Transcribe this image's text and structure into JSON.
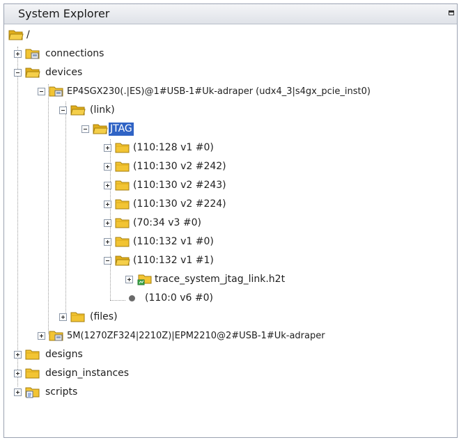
{
  "panel": {
    "title": "System Explorer"
  },
  "tree": {
    "root": "/",
    "connections": "connections",
    "devices": "devices",
    "device1": "EP4SGX230(.|ES)@1#USB-1#Uk-adraper (udx4_3|s4gx_pcie_inst0)",
    "link": "(link)",
    "jtag": "JTAG",
    "jtag_children": [
      "(110:128 v1 #0)",
      "(110:130 v2 #242)",
      "(110:130 v2 #243)",
      "(110:130 v2 #224)",
      "(70:34 v3 #0)",
      "(110:132 v1 #0)",
      "(110:132 v1 #1)"
    ],
    "trace_link": "trace_system_jtag_link.h2t",
    "node_110_0": "(110:0 v6 #0)",
    "files": "(files)",
    "device2": "5M(1270ZF324|2210Z)|EPM2210@2#USB-1#Uk-adraper",
    "designs": "designs",
    "design_instances": "design_instances",
    "scripts": "scripts"
  },
  "colors": {
    "selection": "#2f63c5",
    "folder": "#f2c433"
  },
  "icons": [
    "folder-icon",
    "folder-open-icon",
    "folder-link-icon",
    "script-folder-icon",
    "node-dot-icon"
  ]
}
